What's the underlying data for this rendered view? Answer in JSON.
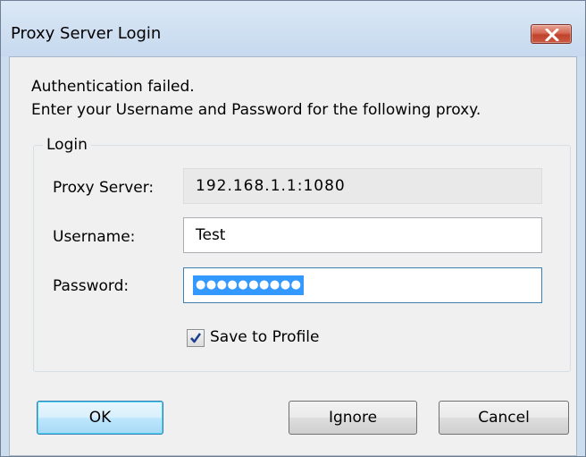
{
  "window": {
    "title": "Proxy Server Login",
    "close_icon": "close-icon"
  },
  "message": {
    "line1": "Authentication failed.",
    "line2": "Enter your Username and Password for the following proxy."
  },
  "login_group": {
    "title": "Login",
    "proxy_server": {
      "label": "Proxy Server:",
      "value": "192.168.1.1:1080"
    },
    "username": {
      "label": "Username:",
      "value": "Test"
    },
    "password": {
      "label": "Password:",
      "masked_value": "●●●●●●●●●●"
    },
    "save_to_profile": {
      "label": "Save to Profile",
      "checked": true
    }
  },
  "buttons": {
    "ok": "OK",
    "ignore": "Ignore",
    "cancel": "Cancel"
  },
  "colors": {
    "close_button": "#c7452e",
    "selection": "#3399ff",
    "focus_border": "#3c7fb1"
  }
}
